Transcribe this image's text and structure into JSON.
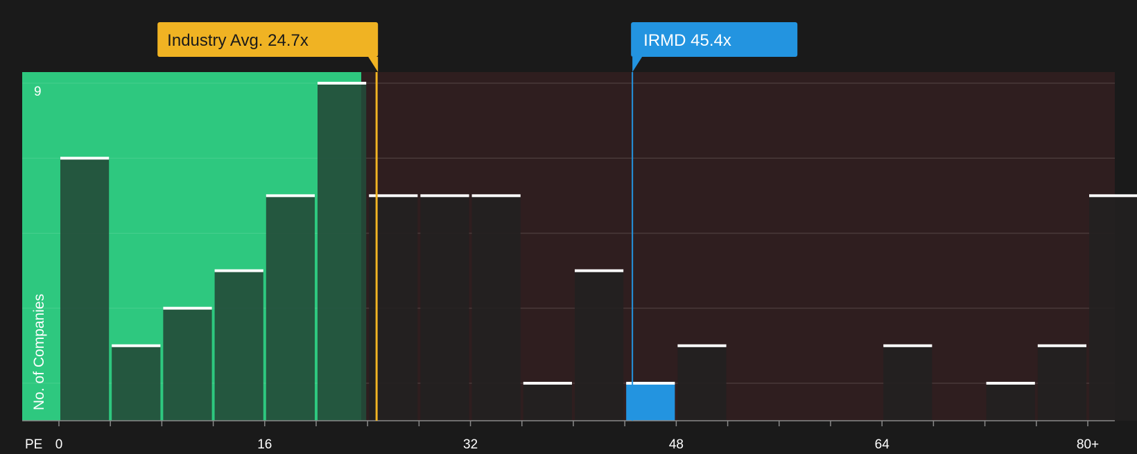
{
  "chart_data": {
    "type": "bar",
    "x_axis_label": "PE",
    "y_axis_label": "No. of Companies",
    "y_top_tick_label": "9",
    "x_tick_labels": [
      "0",
      "16",
      "32",
      "48",
      "64",
      "80+"
    ],
    "x_tick_values": [
      0,
      16,
      32,
      48,
      64,
      80
    ],
    "ylim": [
      0,
      9
    ],
    "xlim": [
      0,
      82
    ],
    "bin_width": 4,
    "bins": [
      {
        "start": 0,
        "value": 7
      },
      {
        "start": 4,
        "value": 2
      },
      {
        "start": 8,
        "value": 3
      },
      {
        "start": 12,
        "value": 4
      },
      {
        "start": 16,
        "value": 6
      },
      {
        "start": 20,
        "value": 9
      },
      {
        "start": 24,
        "value": 6
      },
      {
        "start": 28,
        "value": 6
      },
      {
        "start": 32,
        "value": 6
      },
      {
        "start": 36,
        "value": 1
      },
      {
        "start": 40,
        "value": 4
      },
      {
        "start": 44,
        "value": 1,
        "highlight": true
      },
      {
        "start": 48,
        "value": 2
      },
      {
        "start": 52,
        "value": 0
      },
      {
        "start": 56,
        "value": 0
      },
      {
        "start": 60,
        "value": 0
      },
      {
        "start": 64,
        "value": 2
      },
      {
        "start": 68,
        "value": 0
      },
      {
        "start": 72,
        "value": 1
      },
      {
        "start": 76,
        "value": 2
      },
      {
        "start": 80,
        "value": 6
      }
    ],
    "industry_avg": {
      "label": "Industry Avg. 24.7x",
      "value": 24.7
    },
    "company": {
      "label": "IRMD 45.4x",
      "value": 45.4
    },
    "grid": true,
    "colors": {
      "background": "#1a1a1a",
      "good_zone": "#2ec87f",
      "bad_zone": "#2f1e1f",
      "bar_good": "#244a38",
      "bar_bad": "#222020",
      "bar_highlight": "#2394e0",
      "bar_cap": "#ffffff",
      "industry_marker": "#f0b323",
      "company_marker": "#2394e0",
      "gridline": "#4a3a3a",
      "axis_text": "#ffffff"
    }
  }
}
